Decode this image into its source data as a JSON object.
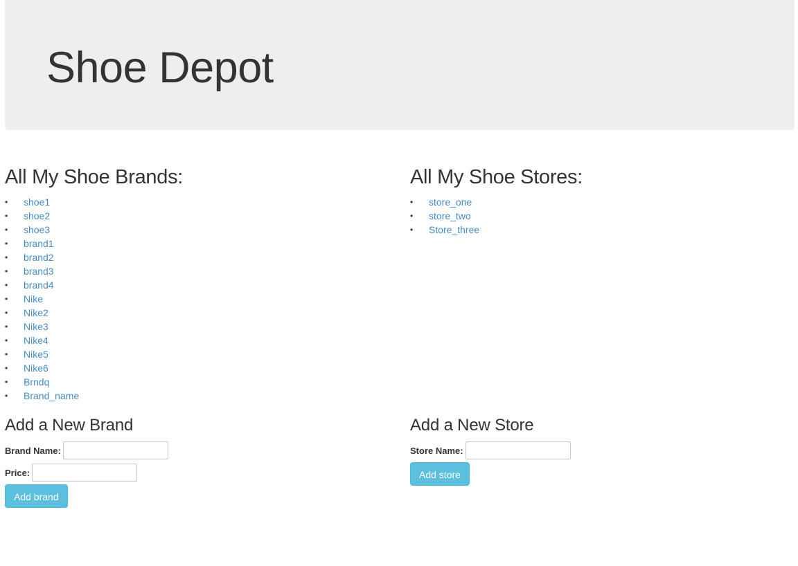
{
  "header": {
    "title": "Shoe Depot"
  },
  "brands": {
    "heading": "All My Shoe Brands:",
    "items": [
      "shoe1",
      "shoe2",
      "shoe3",
      "brand1",
      "brand2",
      "brand3",
      "brand4",
      "Nike",
      "Nike2",
      "Nike3",
      "Nike4",
      "Nike5",
      "Nike6",
      "Brndq",
      "Brand_name"
    ]
  },
  "stores": {
    "heading": "All My Shoe Stores:",
    "items": [
      "store_one",
      "store_two",
      "Store_three"
    ]
  },
  "brand_form": {
    "title": "Add a New Brand",
    "name_label": "Brand Name:",
    "name_value": "",
    "price_label": "Price:",
    "price_value": "",
    "submit_label": "Add brand"
  },
  "store_form": {
    "title": "Add a New Store",
    "name_label": "Store Name:",
    "name_value": "",
    "submit_label": "Add store"
  },
  "colors": {
    "link": "#428bca",
    "button": "#5bc0de",
    "jumbotron": "#eeeeee"
  }
}
